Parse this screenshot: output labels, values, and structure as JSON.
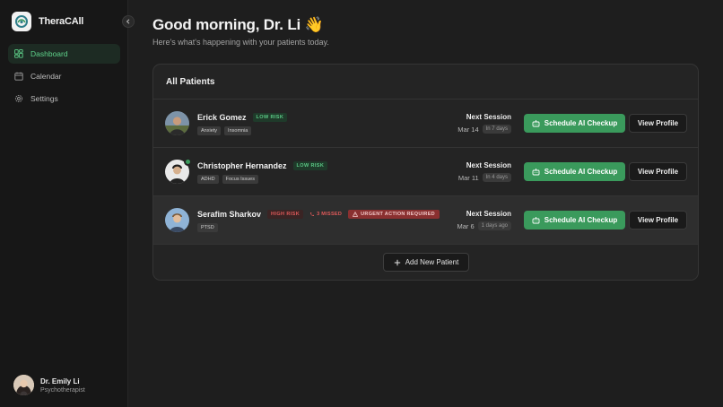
{
  "app": {
    "name": "TheraCAll"
  },
  "sidebar": {
    "items": [
      {
        "label": "Dashboard",
        "icon": "grid-icon",
        "active": true
      },
      {
        "label": "Calendar",
        "icon": "calendar-icon",
        "active": false
      },
      {
        "label": "Settings",
        "icon": "gear-icon",
        "active": false
      }
    ],
    "user": {
      "name": "Dr. Emily Li",
      "role": "Psychotherapist"
    }
  },
  "header": {
    "greeting": "Good morning, Dr. Li 👋",
    "subtitle": "Here's what's happening with your patients today."
  },
  "patients_card": {
    "title": "All Patients",
    "rows": [
      {
        "name": "Erick Gomez",
        "risk": "LOW RISK",
        "risk_level": "low",
        "tags": [
          "Anxiety",
          "Insomnia"
        ],
        "session_label": "Next Session",
        "session_date": "Mar 14",
        "session_relative": "In 7 days",
        "schedule_label": "Schedule AI Checkup",
        "profile_label": "View Profile"
      },
      {
        "name": "Christopher Hernandez",
        "risk": "LOW RISK",
        "risk_level": "low",
        "tags": [
          "ADHD",
          "Focus Issues"
        ],
        "session_label": "Next Session",
        "session_date": "Mar 11",
        "session_relative": "In 4 days",
        "schedule_label": "Schedule AI Checkup",
        "profile_label": "View Profile"
      },
      {
        "name": "Serafim Sharkov",
        "risk": "HIGH RISK",
        "risk_level": "high",
        "missed": "3 MISSED",
        "urgent": "URGENT ACTION REQUIRED",
        "tags": [
          "PTSD"
        ],
        "session_label": "Next Session",
        "session_date": "Mar 6",
        "session_relative": "1 days ago",
        "schedule_label": "Schedule AI Checkup",
        "profile_label": "View Profile"
      }
    ],
    "add_label": "Add New Patient"
  },
  "colors": {
    "accent_green": "#3a9a5c",
    "risk_high": "#e05a5a",
    "urgent_bg": "#8a3030"
  }
}
